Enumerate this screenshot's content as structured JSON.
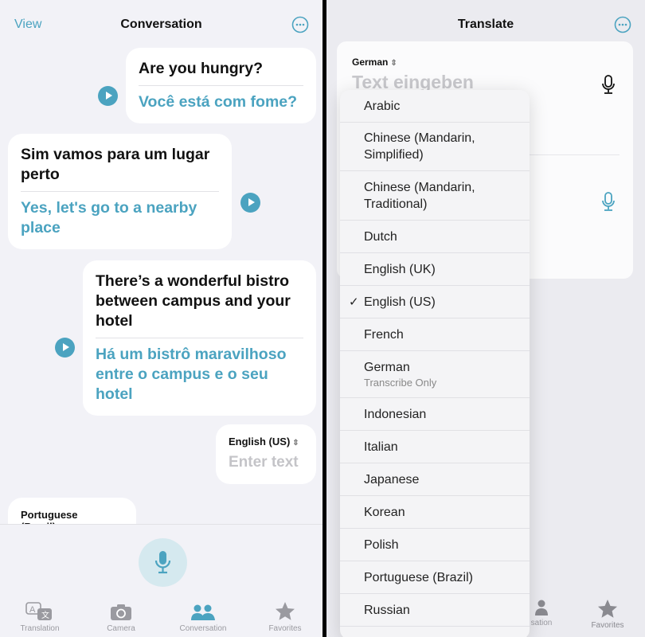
{
  "conversation": {
    "header": {
      "view_label": "View",
      "title": "Conversation",
      "more_icon": "ellipsis-circle-icon"
    },
    "messages": [
      {
        "source": "Are you hungry?",
        "translation": "Você está com fome?"
      },
      {
        "source": "Sim vamos para um lugar perto",
        "translation": "Yes, let's go to a nearby place"
      },
      {
        "source": "There’s a wonderful bistro between campus and your hotel",
        "translation": "Há um bistrô maravilhoso entre o campus e o seu hotel"
      }
    ],
    "input_right": {
      "language": "English (US)",
      "placeholder": "Enter text"
    },
    "input_left": {
      "language": "Portuguese (Brazil)"
    },
    "tabs": [
      {
        "label": "Translation",
        "icon": "translate-bubbles-icon"
      },
      {
        "label": "Camera",
        "icon": "camera-icon"
      },
      {
        "label": "Conversation",
        "icon": "people-icon",
        "active": true
      },
      {
        "label": "Favorites",
        "icon": "star-icon"
      }
    ],
    "accent_color": "#4ba3c0"
  },
  "translate": {
    "header": {
      "title": "Translate",
      "more_icon": "ellipsis-circle-icon"
    },
    "source_language": "German",
    "placeholder": "Text eingeben",
    "language_menu": [
      {
        "label": "Arabic"
      },
      {
        "label": "Chinese (Mandarin, Simplified)"
      },
      {
        "label": "Chinese (Mandarin, Traditional)"
      },
      {
        "label": "Dutch"
      },
      {
        "label": "English (UK)"
      },
      {
        "label": "English (US)",
        "selected": true,
        "check": "✓"
      },
      {
        "label": "French"
      },
      {
        "label": "German",
        "sublabel": "Transcribe Only"
      },
      {
        "label": "Indonesian"
      },
      {
        "label": "Italian"
      },
      {
        "label": "Japanese"
      },
      {
        "label": "Korean"
      },
      {
        "label": "Polish"
      },
      {
        "label": "Portuguese (Brazil)"
      },
      {
        "label": "Russian"
      }
    ],
    "tabs_visible": [
      {
        "label": "sation",
        "icon": "people-icon"
      },
      {
        "label": "Favorites",
        "icon": "star-icon"
      }
    ]
  }
}
